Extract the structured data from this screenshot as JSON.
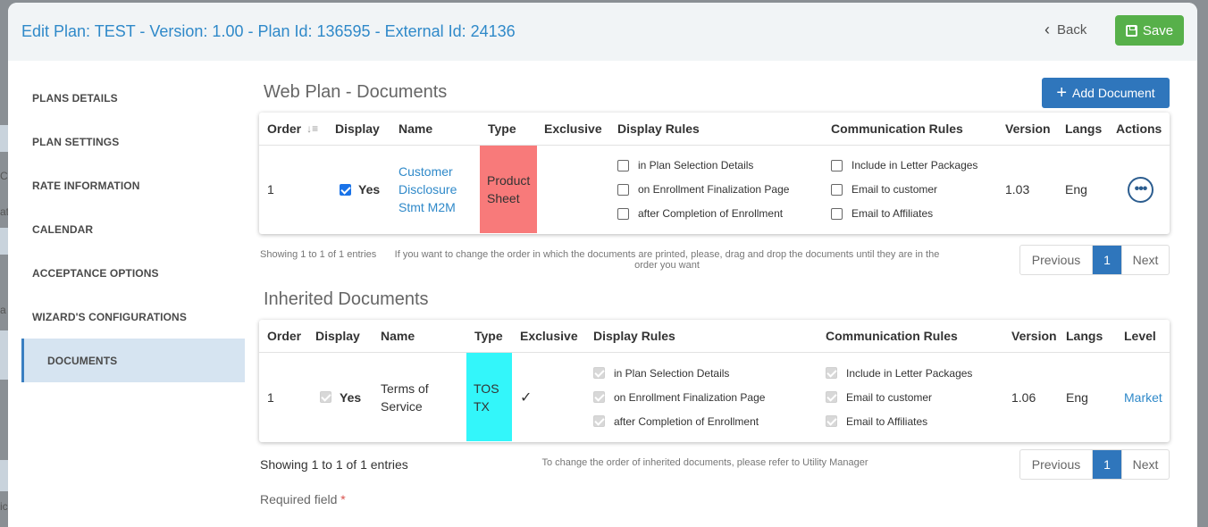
{
  "modal": {
    "title": "Edit Plan: TEST - Version: 1.00 - Plan Id: 136595 - External Id: 24136",
    "back_label": "Back",
    "save_label": "Save"
  },
  "background": {
    "fragments": [
      "Cl",
      "at",
      "a",
      "ic"
    ]
  },
  "sidebar": {
    "items": [
      {
        "label": "PLANS DETAILS"
      },
      {
        "label": "PLAN SETTINGS"
      },
      {
        "label": "RATE INFORMATION"
      },
      {
        "label": "CALENDAR"
      },
      {
        "label": "ACCEPTANCE OPTIONS"
      },
      {
        "label": "WIZARD'S CONFIGURATIONS"
      },
      {
        "label": "DOCUMENTS",
        "active": true
      }
    ]
  },
  "web_docs": {
    "title": "Web Plan - Documents",
    "add_label": "Add Document",
    "columns": [
      "Order",
      "Display",
      "Name",
      "Type",
      "Exclusive",
      "Display Rules",
      "Communication Rules",
      "Version",
      "Langs",
      "Actions"
    ],
    "row": {
      "order": "1",
      "display": "Yes",
      "display_checked": true,
      "name_line1": "Customer",
      "name_line2": "Disclosure",
      "name_line3": "Stmt M2M",
      "type_line1": "Product",
      "type_line2": "Sheet",
      "type_color": "#f87a7a",
      "exclusive": "",
      "display_rules": [
        "in Plan Selection Details",
        "on Enrollment Finalization Page",
        "after Completion of Enrollment"
      ],
      "comm_rules": [
        "Include in Letter Packages",
        "Email to customer",
        "Email to Affiliates"
      ],
      "version": "1.03",
      "langs": "Eng",
      "actions_icon": "ellipsis-icon"
    },
    "showing": "Showing 1 to 1 of 1 entries",
    "note": "If you want to change the order in which the documents are printed, please, drag and drop the documents until they are in the order you want",
    "pager": {
      "previous": "Previous",
      "page": "1",
      "next": "Next"
    }
  },
  "inherited_docs": {
    "title": "Inherited Documents",
    "columns": [
      "Order",
      "Display",
      "Name",
      "Type",
      "Exclusive",
      "Display Rules",
      "Communication Rules",
      "Version",
      "Langs",
      "Level"
    ],
    "row": {
      "order": "1",
      "display": "Yes",
      "name_line1": "Terms of",
      "name_line2": "Service",
      "type_line1": "TOS",
      "type_line2": "TX",
      "type_color": "#33f6fa",
      "exclusive": "✓",
      "display_rules": [
        "in Plan Selection Details",
        "on Enrollment Finalization Page",
        "after Completion of Enrollment"
      ],
      "comm_rules": [
        "Include in Letter Packages",
        "Email to customer",
        "Email to Affiliates"
      ],
      "version": "1.06",
      "langs": "Eng",
      "level": "Market"
    },
    "showing": "Showing 1 to 1 of 1 entries",
    "note": "To change the order of inherited documents, please refer to Utility Manager",
    "pager": {
      "previous": "Previous",
      "page": "1",
      "next": "Next"
    }
  },
  "required": {
    "label": "Required field",
    "marker": "*"
  },
  "colors": {
    "accent": "#2f89c9",
    "primary_button": "#2f76bc",
    "save_button": "#57b04a",
    "active_nav": "#d6e4f1"
  }
}
